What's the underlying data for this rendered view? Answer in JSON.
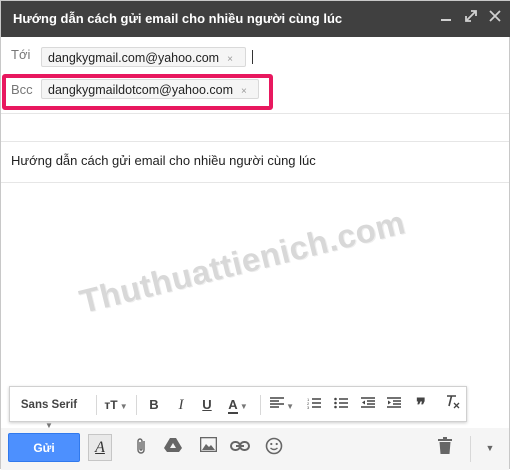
{
  "window": {
    "title": "Hướng dẫn cách gửi email cho nhiều người cùng lúc",
    "minimize_icon": "minimize-icon",
    "popout_icon": "popout-icon",
    "close_icon": "close-icon"
  },
  "recipients": {
    "to_label": "Tới",
    "to_chip": "dangkygmail.com@yahoo.com",
    "bcc_label": "Bcc",
    "bcc_chip": "dangkygmaildotcom@yahoo.com",
    "remove_symbol": "×"
  },
  "subject": "Hướng dẫn cách gửi email cho nhiều người cùng lúc",
  "watermark": "Thuthuattienich.com",
  "format_toolbar": {
    "font": "Sans Serif",
    "items": [
      "font-size-icon",
      "bold-icon",
      "italic-icon",
      "underline-icon",
      "text-color-icon",
      "align-icon",
      "numbered-list-icon",
      "bulleted-list-icon",
      "indent-less-icon",
      "indent-more-icon",
      "quote-icon",
      "remove-formatting-icon"
    ]
  },
  "bottom_bar": {
    "send_label": "Gửi",
    "icons": [
      "formatting-icon",
      "attach-icon",
      "drive-icon",
      "photo-icon",
      "link-icon",
      "emoji-icon",
      "trash-icon",
      "more-options-icon"
    ]
  },
  "colors": {
    "titlebar": "#404040",
    "send_button": "#4d90fe",
    "highlight_border": "#e8185f",
    "bottom_bar": "#f5f5f5"
  }
}
